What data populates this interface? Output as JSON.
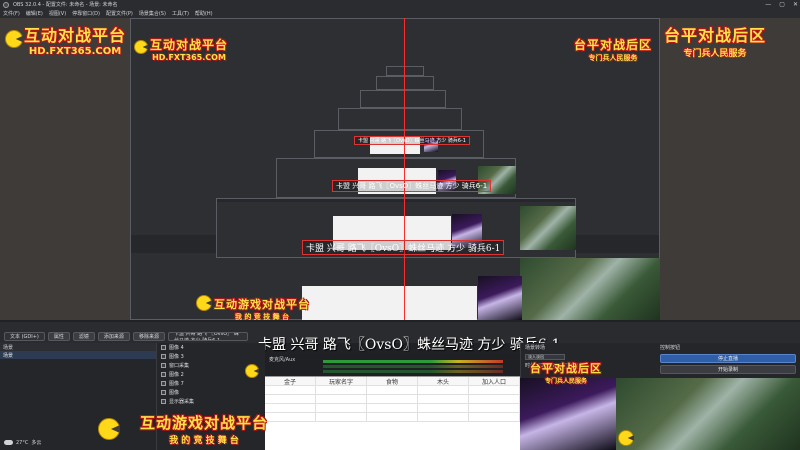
{
  "app": {
    "title": "OBS 32.0.4 - 配置文件: 未命名 - 场景: 未命名",
    "window_controls": [
      "—",
      "▢",
      "✕"
    ]
  },
  "menu": [
    "文件(F)",
    "编辑(E)",
    "视图(V)",
    "停靠窗口(D)",
    "配置文件(P)",
    "场景集合(S)",
    "工具(T)",
    "帮助(H)"
  ],
  "overlay": {
    "logo_left_main": "互动对战平台",
    "logo_left_sub": "HD.FXT365.COM",
    "logo_right_main": "台平对战后区",
    "logo_right_sub": "专门兵人民服务",
    "logo_bottom_main": "互动游戏对战平台",
    "logo_bottom_sub": "我 的 竞 技 舞 台",
    "banner_text": "卡盟 兴哥 路飞〖OvsO〗蛛丝马迹 方少 骑兵6-1",
    "colors": {
      "logo_yellow": "#ffe14a",
      "logo_red": "#b31717",
      "guide_line": "#ff2a2a"
    }
  },
  "docks": {
    "scenes_header": "场景",
    "scene_item": "场景",
    "sources_header": "来源",
    "sources": [
      {
        "label": "图像 4",
        "icon": "image-icon"
      },
      {
        "label": "图像 3",
        "icon": "image-icon"
      },
      {
        "label": "窗口采集",
        "icon": "window-icon"
      },
      {
        "label": "图像 2",
        "icon": "image-icon"
      },
      {
        "label": "图像 7",
        "icon": "image-icon"
      },
      {
        "label": "图像",
        "icon": "image-icon"
      },
      {
        "label": "显示器采集",
        "icon": "monitor-icon"
      }
    ],
    "mixer_label": "麦克风/Aux",
    "transition_header": "场景转场",
    "controls_header": "控制按钮"
  },
  "toolbar": {
    "source_name": "文本 (GDI+)",
    "buttons": [
      "属性",
      "滤镜",
      "添加来源",
      "移除来源"
    ],
    "text_field": "卡盟 兴哥 路飞 〖OvsO〗 蛛丝马迹 方少 骑兵6-1"
  },
  "spreadsheet": {
    "columns": [
      "金子",
      "玩家名字",
      "食物",
      "木头",
      "加入人口"
    ]
  },
  "transition": {
    "type_value": "淡入淡出",
    "duration_label": "时长",
    "duration_value": "300 ms"
  },
  "controls": {
    "start_stream": "停止直播",
    "start_record": "开始录制"
  },
  "status": {
    "temperature": "27°C",
    "condition": "多云"
  }
}
